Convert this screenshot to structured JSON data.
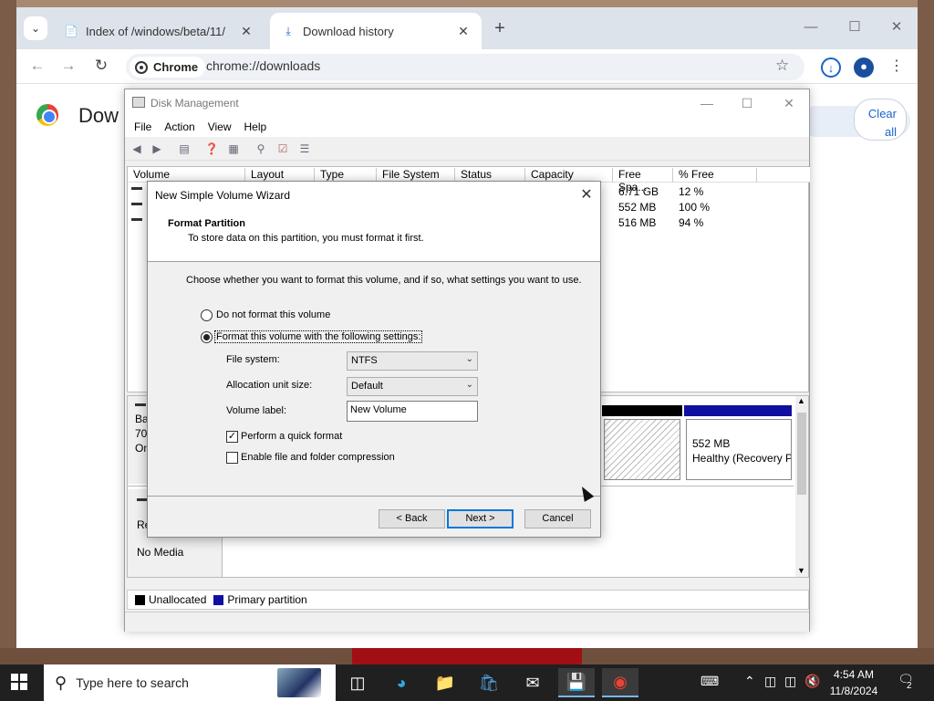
{
  "chrome": {
    "tabs": [
      {
        "title": "Index of /windows/beta/11/",
        "icon": "document-icon"
      },
      {
        "title": "Download history",
        "icon": "download-icon"
      }
    ],
    "omnibox": {
      "chip_label": "Chrome",
      "url": "chrome://downloads"
    },
    "page_title": "Dow",
    "clear_all_label": "Clear all"
  },
  "disk_management": {
    "title": "Disk Management",
    "menu": [
      "File",
      "Action",
      "View",
      "Help"
    ],
    "columns": [
      "Volume",
      "Layout",
      "Type",
      "File System",
      "Status",
      "Capacity",
      "Free Spa...",
      "% Free"
    ],
    "rows": [
      {
        "free": "6.71 GB",
        "pct": "12 %"
      },
      {
        "free": "552 MB",
        "pct": "100 %"
      },
      {
        "free": "516 MB",
        "pct": "94 %"
      }
    ],
    "disk0_label": [
      "Ba",
      "70.",
      "On"
    ],
    "recovery_partition": [
      "552 MB",
      "Healthy (Recovery P"
    ],
    "cdrom_label": [
      "Re",
      "No Media"
    ],
    "legend": [
      {
        "label": "Unallocated",
        "color": "#000000"
      },
      {
        "label": "Primary partition",
        "color": "#1010a0"
      }
    ]
  },
  "wizard": {
    "title": "New Simple Volume Wizard",
    "heading": "Format Partition",
    "subheading": "To store data on this partition, you must format it first.",
    "intro": "Choose whether you want to format this volume, and if so, what settings you want to use.",
    "option_no_format": "Do not format this volume",
    "option_format": "Format this volume with the following settings:",
    "file_system_label": "File system:",
    "file_system_value": "NTFS",
    "allocation_label": "Allocation unit size:",
    "allocation_value": "Default",
    "volume_label_label": "Volume label:",
    "volume_label_value": "New Volume",
    "quick_format_label": "Perform a quick format",
    "compression_label": "Enable file and folder compression",
    "quick_format_checked": true,
    "compression_checked": false,
    "back_label": "< Back",
    "next_label": "Next >",
    "cancel_label": "Cancel"
  },
  "taskbar": {
    "search_placeholder": "Type here to search",
    "time": "4:54 AM",
    "date": "11/8/2024",
    "notification_count": "2"
  }
}
